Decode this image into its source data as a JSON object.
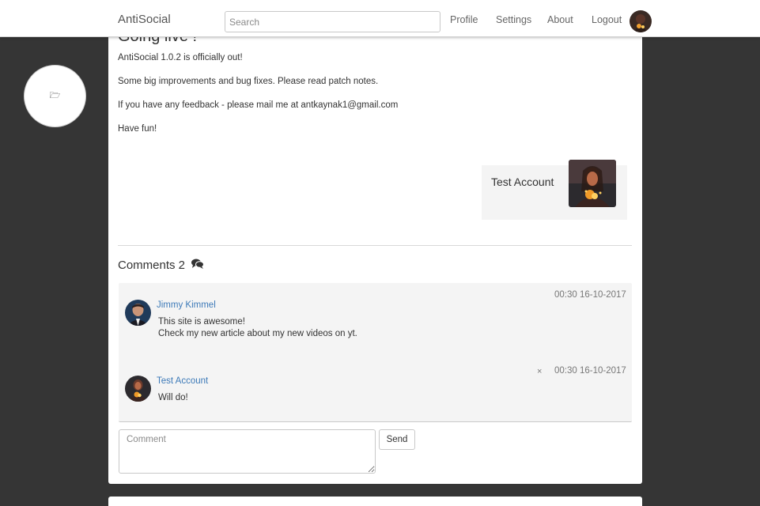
{
  "nav": {
    "brand": "AntiSocial",
    "search_placeholder": "Search",
    "links": [
      "Profile",
      "Settings",
      "About",
      "Logout"
    ]
  },
  "fab": {
    "icon": "folder-open-icon",
    "glyph": "🗁"
  },
  "post": {
    "title": "Going live !",
    "lines": [
      "AntiSocial 1.0.2 is officially out!",
      "Some big improvements and bug fixes. Please read patch notes.",
      "If you have any feedback - please mail me at antkaynak1@gmail.com",
      "Have fun!"
    ],
    "author": "Test Account"
  },
  "comments": {
    "heading": "Comments 2",
    "icon": "comments-icon",
    "items": [
      {
        "user": "Jimmy Kimmel",
        "time": "00:30 16-10-2017",
        "lines": [
          "This site is awesome!",
          "Check my new article about my new videos on yt."
        ]
      },
      {
        "user": "Test Account",
        "time": "00:30 16-10-2017",
        "delete": "×",
        "lines": [
          "Will do!"
        ]
      }
    ]
  },
  "composer": {
    "placeholder": "Comment",
    "send_label": "Send"
  },
  "colors": {
    "background": "#353535",
    "link": "#3d7ab8",
    "comment_bg": "#f4f4f4"
  }
}
